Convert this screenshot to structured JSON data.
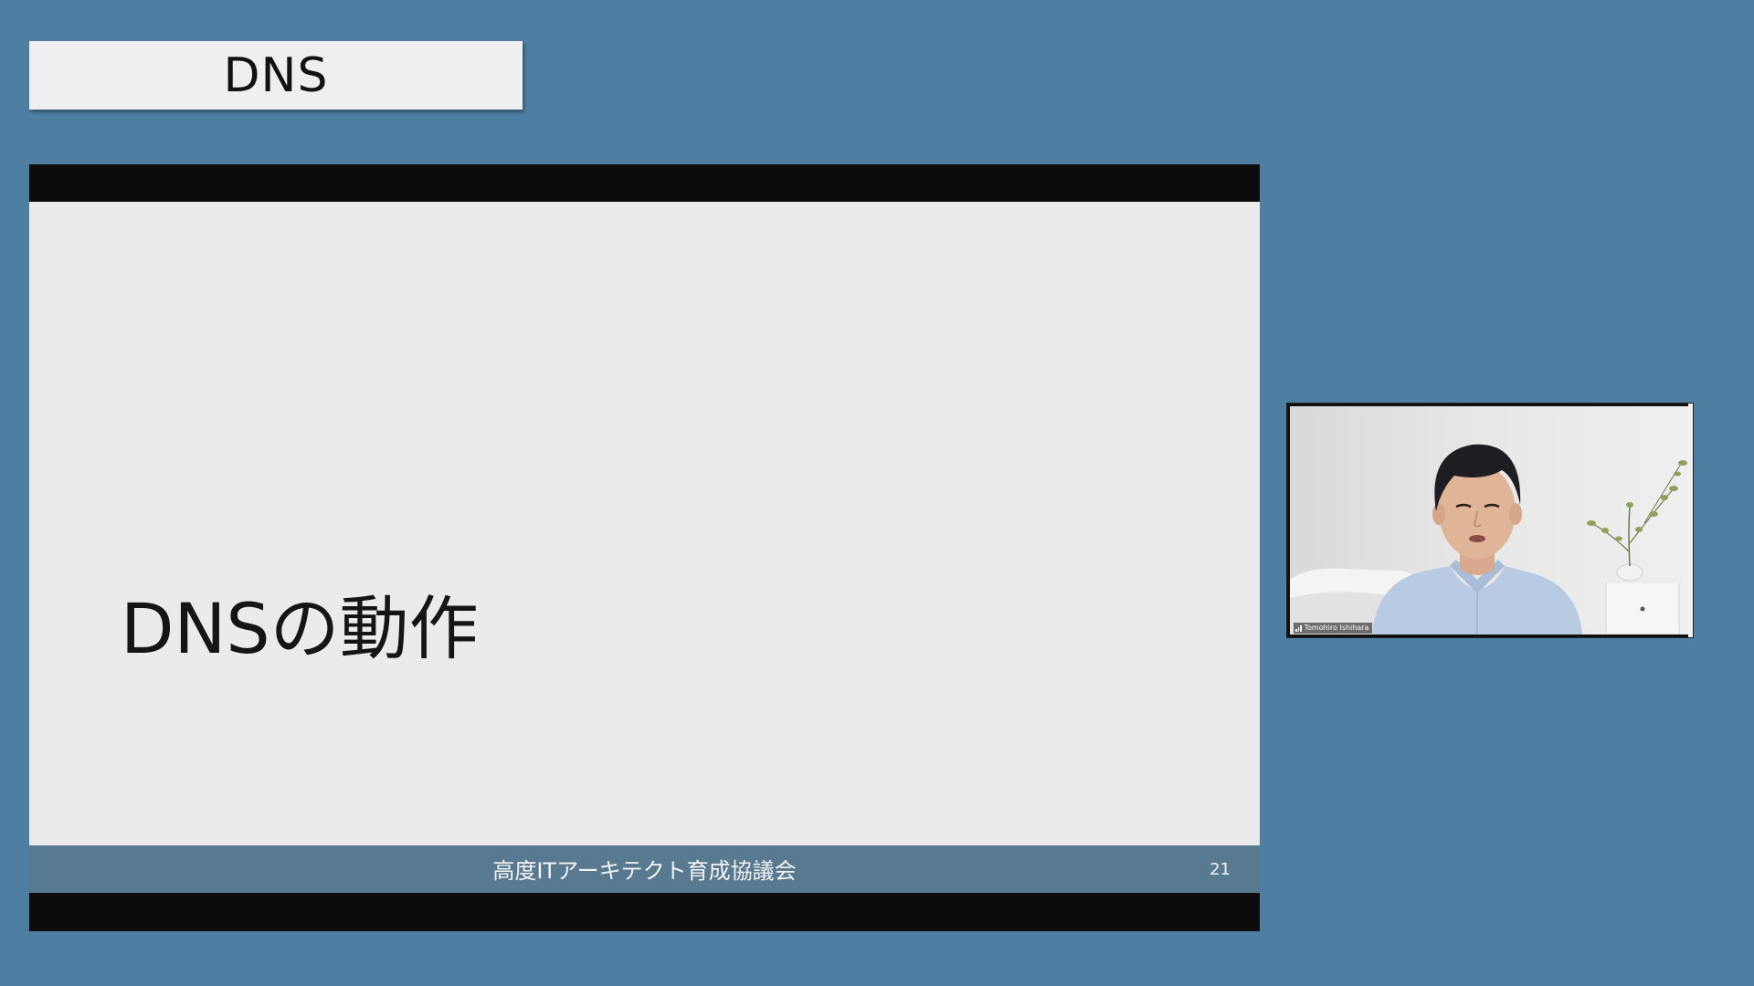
{
  "header": {
    "title": "DNS"
  },
  "slide": {
    "heading": "DNSの動作",
    "footer_org": "高度ITアーキテクト育成協議会",
    "page_number": "21"
  },
  "video": {
    "participant_name": "Tomohiro Ishihara"
  },
  "colors": {
    "background": "#4e7fa3",
    "slide_background": "#ebebeb",
    "slide_footer": "#587a90",
    "letterbox": "#0c0c0c"
  }
}
